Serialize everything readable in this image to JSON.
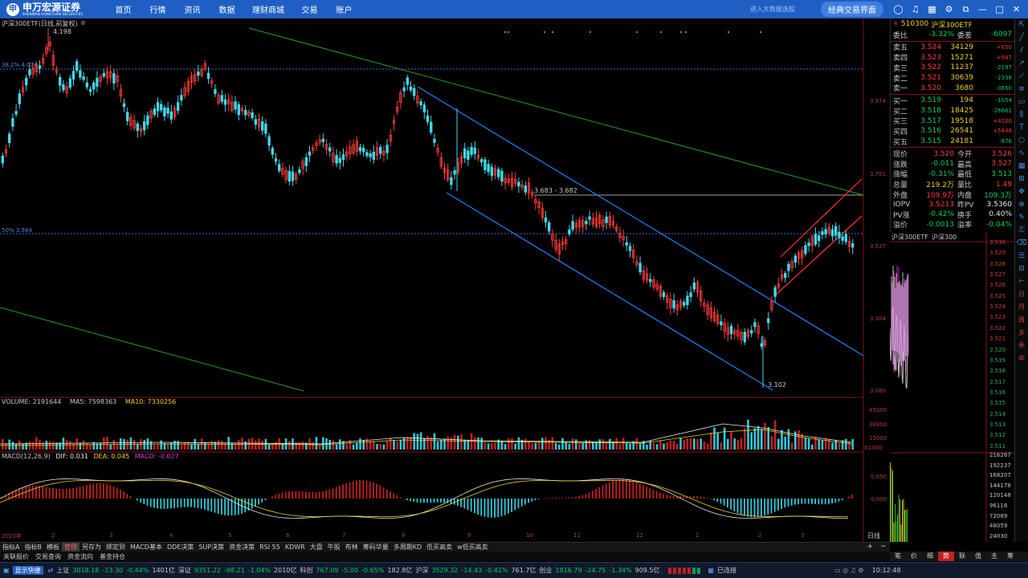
{
  "topbar": {
    "logo_cn": "申万宏源证券",
    "logo_en": "SHENWAN HONGYUAN SECURITIES",
    "nav": [
      "首页",
      "行情",
      "资讯",
      "数据",
      "理财商城",
      "交易",
      "账户"
    ],
    "hint": "进入大数据选股",
    "classic_button": "经典交易界面"
  },
  "chart": {
    "title": "沪深300ETF(日线,前复权)",
    "high_marker": "4.198",
    "low_marker": "3.102",
    "fib_382": "38.2% 4.074",
    "fib_50": "50% 3.584",
    "range_label": "3.683 - 3.682",
    "y_ticks": [
      "3.974",
      "3.751",
      "3.527",
      "3.304",
      "3.080"
    ],
    "month_labels": [
      "2023年",
      "2",
      "3",
      "4",
      "5",
      "6",
      "7",
      "8",
      "9",
      "10",
      "11",
      "12",
      "1",
      "2",
      "3"
    ]
  },
  "volume": {
    "label": "VOLUME: 2191644",
    "ma5": "MA5: 7598363",
    "ma10": "MA10: 7330256",
    "ticks": [
      "45000",
      "30000",
      "15000",
      "X1000"
    ]
  },
  "macd": {
    "label": "MACD(12,26,9)",
    "dif": "DIF: 0.031",
    "dea": "DEA: 0.045",
    "macd": "MACD: -0.027",
    "ticks": [
      "0.050",
      "0.000"
    ]
  },
  "quote": {
    "code": "510300",
    "name": "沪深300ETF",
    "wei_bi_label": "委比",
    "wei_bi": "-3.32%",
    "wei_cha_label": "委差",
    "wei_cha": "-6097",
    "asks": [
      {
        "label": "卖五",
        "price": "3.524",
        "vol": "34129",
        "chg": "+650"
      },
      {
        "label": "卖四",
        "price": "3.523",
        "vol": "15271",
        "chg": "+547"
      },
      {
        "label": "卖三",
        "price": "3.522",
        "vol": "11237",
        "chg": "-2197"
      },
      {
        "label": "卖二",
        "price": "3.521",
        "vol": "30639",
        "chg": "-2338"
      },
      {
        "label": "卖一",
        "price": "3.520",
        "vol": "3680",
        "chg": "-3650"
      }
    ],
    "bids": [
      {
        "label": "买一",
        "price": "3.519",
        "vol": "194",
        "chg": "-1054"
      },
      {
        "label": "买二",
        "price": "3.518",
        "vol": "18425",
        "chg": "-26661"
      },
      {
        "label": "买三",
        "price": "3.517",
        "vol": "19518",
        "chg": "+4100"
      },
      {
        "label": "买四",
        "price": "3.516",
        "vol": "26541",
        "chg": "+5848"
      },
      {
        "label": "买五",
        "price": "3.515",
        "vol": "24181",
        "chg": "-876"
      }
    ],
    "stats": [
      {
        "l1": "现价",
        "v1": "3.520",
        "c1": "red",
        "l2": "今开",
        "v2": "3.526",
        "c2": "red"
      },
      {
        "l1": "涨跌",
        "v1": "-0.011",
        "c1": "green",
        "l2": "最高",
        "v2": "3.527",
        "c2": "red"
      },
      {
        "l1": "涨幅",
        "v1": "-0.31%",
        "c1": "green",
        "l2": "最低",
        "v2": "3.513",
        "c2": "green"
      },
      {
        "l1": "总量",
        "v1": "219.2万",
        "c1": "yellow",
        "l2": "量比",
        "v2": "1.49",
        "c2": "red"
      },
      {
        "l1": "外盘",
        "v1": "109.9万",
        "c1": "red",
        "l2": "内盘",
        "v2": "109.3万",
        "c2": "green"
      },
      {
        "l1": "IOPV",
        "v1": "3.5213",
        "c1": "red",
        "l2": "昨PV",
        "v2": "3.5360",
        "c2": "white"
      },
      {
        "l1": "PV涨",
        "v1": "-0.42%",
        "c1": "green",
        "l2": "换手",
        "v2": "0.40%",
        "c2": "white"
      },
      {
        "l1": "溢价",
        "v1": "-0.0013",
        "c1": "green",
        "l2": "溢率",
        "v2": "-0.04%",
        "c2": "green"
      }
    ]
  },
  "intraday": {
    "tab1": "沪深300ETF",
    "tab2": "沪深300",
    "price_ticks": [
      "3.530",
      "3.529",
      "3.528",
      "3.527",
      "3.526",
      "3.525",
      "3.524",
      "3.523",
      "3.522",
      "3.521",
      "3.520",
      "3.519",
      "3.518",
      "3.517",
      "3.516",
      "3.515",
      "3.514",
      "3.513",
      "3.512",
      "3.511"
    ],
    "vol_ticks": [
      "216267",
      "192237",
      "168207",
      "144178",
      "120148",
      "96118",
      "72089",
      "48059",
      "24030"
    ]
  },
  "icon_col_text": [
    "日",
    "月",
    "周",
    "多",
    "季",
    "年"
  ],
  "tabs1": [
    "指标A",
    "指标B",
    "模板",
    "管理",
    "另存为",
    "绑定到",
    "MACD基本",
    "DDE决策",
    "SUP决策",
    "资金决策",
    "RSI 55",
    "KDWR",
    "大盘",
    "牛股",
    "布林",
    "筹码华量",
    "多周期KD",
    "低买高卖",
    "w低买高卖"
  ],
  "tabs1_active": "管理",
  "tabs2": [
    "关联报价",
    "交易查询",
    "资金流向",
    "基金持仓"
  ],
  "period_label": "日线",
  "period_tabs": [
    "笔",
    "价",
    "细",
    "势",
    "联",
    "值",
    "主",
    "筹"
  ],
  "period_active": "势",
  "status": {
    "tag": "显示快捷",
    "sh": "上证",
    "sh_val": "3018.18",
    "sh_chg": "-13.30",
    "sh_pct": "-0.44%",
    "sh_amt": "1401亿",
    "sz": "深证",
    "sz_val": "9351.22",
    "sz_chg": "-98.21",
    "sz_pct": "-1.04%",
    "sz_amt": "2010亿",
    "kc": "科创",
    "kc_val": "767.09",
    "kc_chg": "-5.00",
    "kc_pct": "-0.65%",
    "kc_amt": "182.8亿",
    "hs": "沪深",
    "hs_val": "3529.32",
    "hs_chg": "-14.43",
    "hs_pct": "-0.41%",
    "hs_amt": "761.7亿",
    "cy": "创业",
    "cy_val": "1816.79",
    "cy_chg": "-24.75",
    "cy_pct": "-1.34%",
    "cy_amt": "909.5亿",
    "conn": "已连接",
    "time": "10:12:48"
  }
}
